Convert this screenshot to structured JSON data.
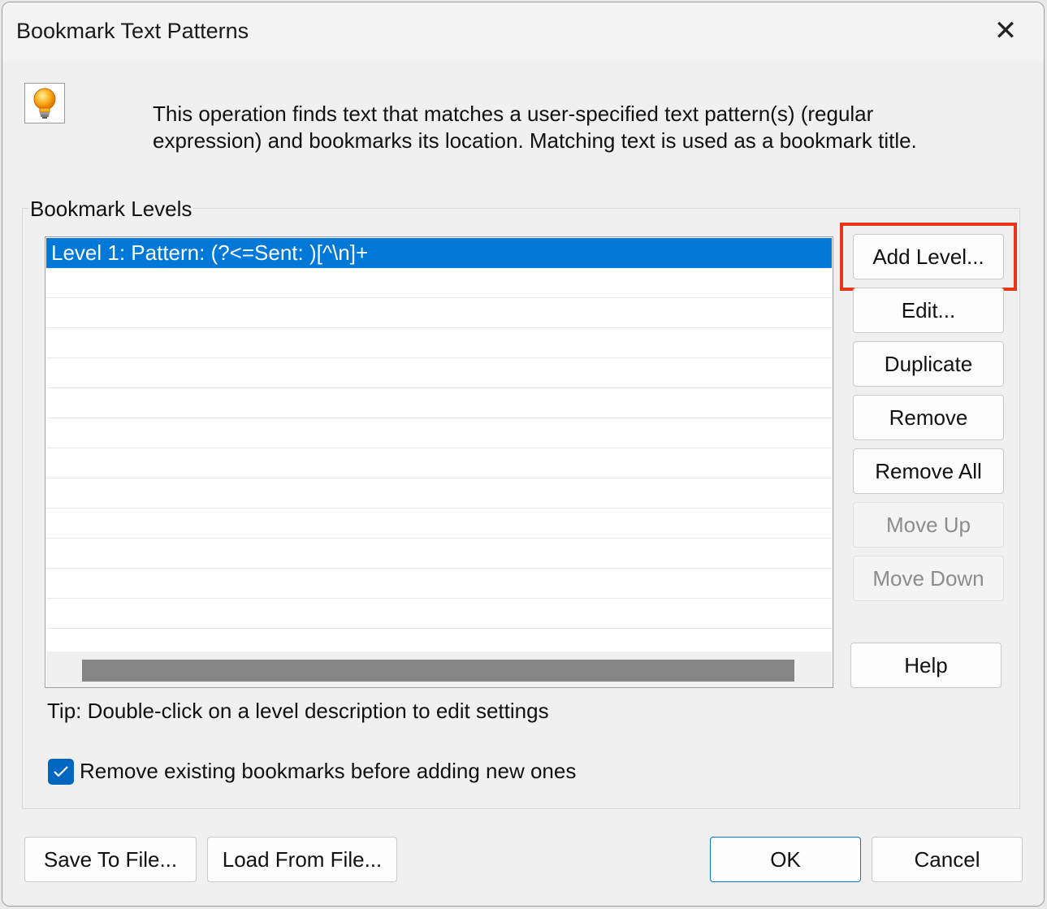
{
  "window": {
    "title": "Bookmark Text Patterns",
    "close_glyph": "✕"
  },
  "info": {
    "icon": "lightbulb-icon",
    "description_line1": "This operation finds text that matches a user-specified text pattern(s) (regular",
    "description_line2": "expression) and bookmarks its location. Matching text is used as a bookmark title."
  },
  "levels": {
    "group_label": "Bookmark Levels",
    "items": [
      "Level 1: Pattern: (?<=Sent: )[^\\n]+"
    ],
    "selected_index": 0,
    "tip": "Tip: Double-click on a level description to edit settings"
  },
  "side_buttons": {
    "add_level": "Add Level...",
    "edit": "Edit...",
    "duplicate": "Duplicate",
    "remove": "Remove",
    "remove_all": "Remove All",
    "move_up": "Move Up",
    "move_down": "Move Down",
    "help": "Help"
  },
  "options": {
    "remove_existing_label": "Remove existing bookmarks before adding new ones",
    "remove_existing_checked": true
  },
  "footer": {
    "save": "Save To File...",
    "load": "Load From File...",
    "ok": "OK",
    "cancel": "Cancel"
  },
  "colors": {
    "selection": "#0078d7",
    "highlight_box": "#e8351a",
    "checkbox": "#0067c0"
  }
}
